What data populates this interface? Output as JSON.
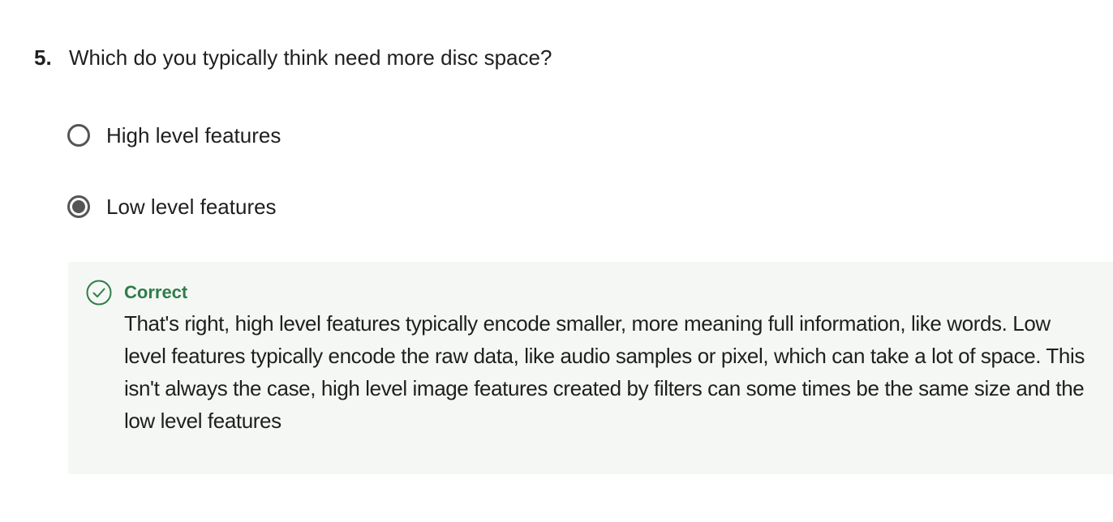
{
  "question": {
    "number": "5.",
    "text": "Which do you typically think need more disc space?"
  },
  "options": [
    {
      "label": "High level features",
      "selected": false
    },
    {
      "label": "Low level features",
      "selected": true
    }
  ],
  "feedback": {
    "status": "Correct",
    "icon": "check-circle-icon",
    "message": "That's right, high level features typically encode smaller, more meaning full information, like words. Low level features typically encode the raw data, like audio samples or pixel, which can take a lot of space. This isn't always the case, high level image features created by filters can some times be the same size and the low level features",
    "accent_color": "#2e7d4a",
    "background_color": "#f5f7f5"
  }
}
